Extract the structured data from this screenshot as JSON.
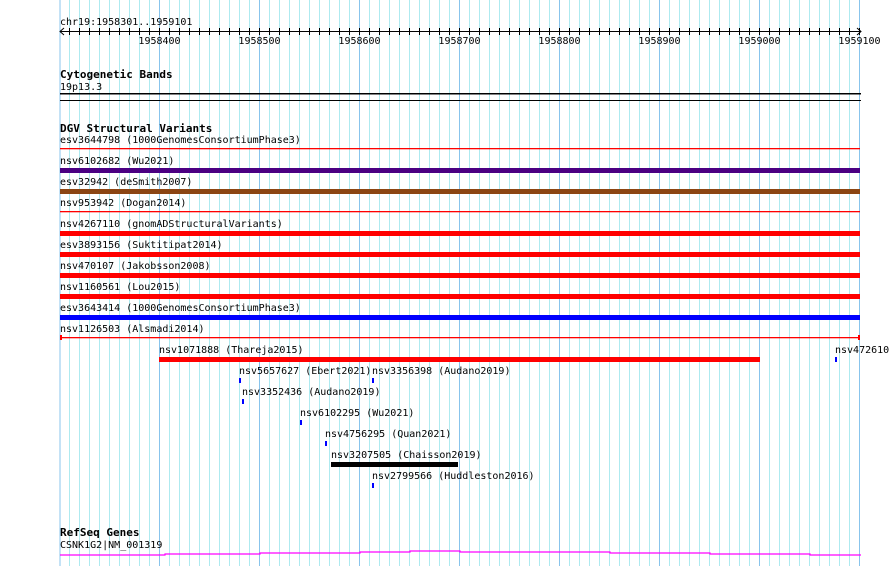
{
  "view": {
    "chrom": "chr19",
    "start": 1958301,
    "end": 1959101,
    "location_label": "chr19:1958301..1959101"
  },
  "ruler": {
    "tick_labels": [
      "1958400",
      "1958500",
      "1958600",
      "1958700",
      "1958800",
      "1958900",
      "1959000",
      "1959100"
    ]
  },
  "colors": {
    "grid_minor": "#aeeaf0",
    "grid_major": "#88c4ec",
    "red": "#ff0000",
    "purple": "#4b0082",
    "brown": "#8b4513",
    "blue": "#0000ff",
    "black": "#000000",
    "magenta": "#ff00ff"
  },
  "tracks": {
    "cytoband": {
      "title": "Cytogenetic Bands",
      "band": "19p13.3"
    },
    "dgv": {
      "title": "DGV Structural Variants",
      "features": [
        {
          "name": "esv3644798",
          "source": "1000GenomesConsortiumPhase3",
          "start": 1958301,
          "end": 1959101,
          "color": "#ff0000",
          "style": "line"
        },
        {
          "name": "nsv6102682",
          "source": "Wu2021",
          "start": 1958301,
          "end": 1959101,
          "color": "#4b0082",
          "style": "bar"
        },
        {
          "name": "esv32942",
          "source": "deSmith2007",
          "start": 1958301,
          "end": 1959101,
          "color": "#8b4513",
          "style": "bar"
        },
        {
          "name": "nsv953942",
          "source": "Dogan2014",
          "start": 1958301,
          "end": 1959101,
          "color": "#ff0000",
          "style": "line"
        },
        {
          "name": "nsv4267110",
          "source": "gnomADStructuralVariants",
          "start": 1958301,
          "end": 1959101,
          "color": "#ff0000",
          "style": "bar"
        },
        {
          "name": "esv3893156",
          "source": "Suktitipat2014",
          "start": 1958301,
          "end": 1959101,
          "color": "#ff0000",
          "style": "bar"
        },
        {
          "name": "nsv470107",
          "source": "Jakobsson2008",
          "start": 1958301,
          "end": 1959101,
          "color": "#ff0000",
          "style": "bar"
        },
        {
          "name": "nsv1160561",
          "source": "Lou2015",
          "start": 1958301,
          "end": 1959101,
          "color": "#ff0000",
          "style": "bar"
        },
        {
          "name": "esv3643414",
          "source": "1000GenomesConsortiumPhase3",
          "start": 1958301,
          "end": 1959101,
          "color": "#0000ff",
          "style": "bar"
        },
        {
          "name": "nsv1126503",
          "source": "Alsmadi2014",
          "start": 1958301,
          "end": 1959101,
          "color": "#ff0000",
          "style": "capped-line"
        },
        {
          "name": "nsv1071888",
          "source": "Thareja2015",
          "start": 1958400,
          "end": 1959001,
          "color": "#ff0000",
          "style": "bar"
        },
        {
          "name": "nsv472610",
          "source": "",
          "start": 1959076,
          "end": 1959077,
          "color": "#0000ff",
          "style": "bar"
        },
        {
          "name": "nsv5657627",
          "source": "Ebert2021",
          "start": 1958480,
          "end": 1958481,
          "color": "#0000ff",
          "style": "bar"
        },
        {
          "name": "nsv3356398",
          "source": "Audano2019",
          "start": 1958613,
          "end": 1958614,
          "color": "#0000ff",
          "style": "bar"
        },
        {
          "name": "nsv3352436",
          "source": "Audano2019",
          "start": 1958483,
          "end": 1958484,
          "color": "#0000ff",
          "style": "bar"
        },
        {
          "name": "nsv6102295",
          "source": "Wu2021",
          "start": 1958541,
          "end": 1958542,
          "color": "#0000ff",
          "style": "bar"
        },
        {
          "name": "nsv4756295",
          "source": "Quan2021",
          "start": 1958566,
          "end": 1958567,
          "color": "#0000ff",
          "style": "bar"
        },
        {
          "name": "nsv3207505",
          "source": "Chaisson2019",
          "start": 1958572,
          "end": 1958699,
          "color": "#000000",
          "style": "bar"
        },
        {
          "name": "nsv2799566",
          "source": "Huddleston2016",
          "start": 1958613,
          "end": 1958614,
          "color": "#0000ff",
          "style": "bar"
        }
      ]
    },
    "refseq": {
      "title": "RefSeq Genes",
      "gene": "CSNK1G2|NM_001319",
      "color": "#ff00ff"
    }
  }
}
